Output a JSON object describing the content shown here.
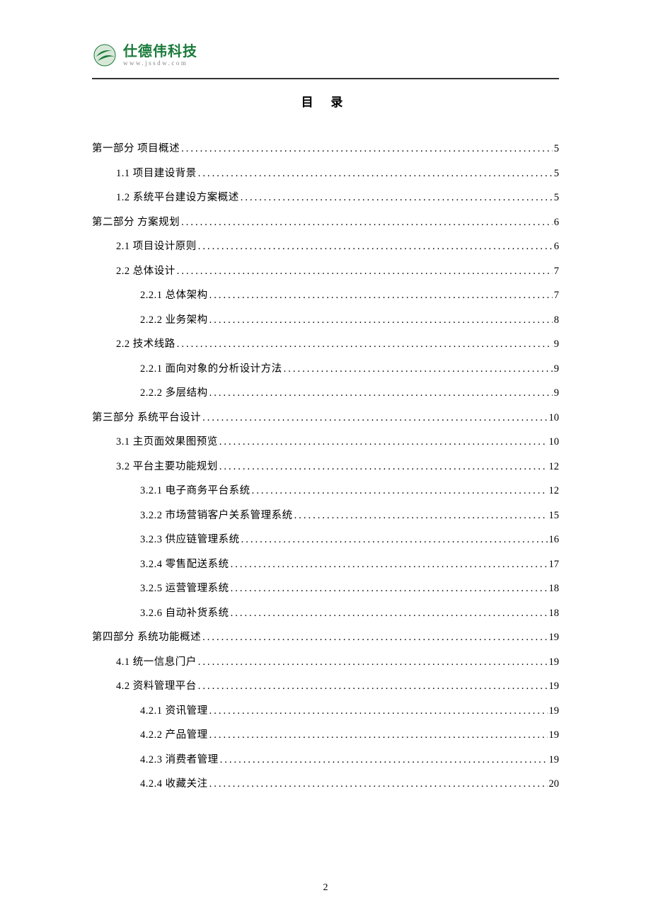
{
  "header": {
    "logo_main": "仕德伟科技",
    "logo_sub": "www.jssdw.com"
  },
  "title": "目 录",
  "toc": [
    {
      "level": 0,
      "label": "第一部分 项目概述",
      "page": "5"
    },
    {
      "level": 1,
      "label": "1.1 项目建设背景",
      "page": "5"
    },
    {
      "level": 1,
      "label": "1.2 系统平台建设方案概述",
      "page": "5"
    },
    {
      "level": 0,
      "label": "第二部分 方案规划",
      "page": "6"
    },
    {
      "level": 1,
      "label": "2.1 项目设计原则",
      "page": "6"
    },
    {
      "level": 1,
      "label": "2.2 总体设计",
      "page": "7"
    },
    {
      "level": 2,
      "label": "2.2.1 总体架构",
      "page": "7"
    },
    {
      "level": 2,
      "label": "2.2.2 业务架构",
      "page": "8"
    },
    {
      "level": 1,
      "label": "2.2 技术线路",
      "page": "9"
    },
    {
      "level": 2,
      "label": "2.2.1 面向对象的分析设计方法",
      "page": "9"
    },
    {
      "level": 2,
      "label": "2.2.2 多层结构",
      "page": "9"
    },
    {
      "level": 0,
      "label": "第三部分 系统平台设计",
      "page": "10"
    },
    {
      "level": 1,
      "label": "3.1 主页面效果图预览",
      "page": "10"
    },
    {
      "level": 1,
      "label": "3.2 平台主要功能规划",
      "page": "12"
    },
    {
      "level": 2,
      "label": "3.2.1 电子商务平台系统",
      "page": "12"
    },
    {
      "level": 2,
      "label": "3.2.2 市场营销客户关系管理系统",
      "page": "15"
    },
    {
      "level": 2,
      "label": "3.2.3 供应链管理系统 ",
      "page": "16"
    },
    {
      "level": 2,
      "label": "3.2.4 零售配送系统",
      "page": "17"
    },
    {
      "level": 2,
      "label": "3.2.5 运营管理系统",
      "page": "18"
    },
    {
      "level": 2,
      "label": "3.2.6 自动补货系统",
      "page": "18"
    },
    {
      "level": 0,
      "label": "第四部分 系统功能概述",
      "page": "19"
    },
    {
      "level": 1,
      "label": "4.1 统一信息门户",
      "page": "19"
    },
    {
      "level": 1,
      "label": "4.2 资料管理平台",
      "page": "19"
    },
    {
      "level": 2,
      "label": "4.2.1 资讯管理",
      "page": "19"
    },
    {
      "level": 2,
      "label": "4.2.2 产品管理",
      "page": "19"
    },
    {
      "level": 2,
      "label": "4.2.3 消费者管理",
      "page": "19"
    },
    {
      "level": 2,
      "label": "4.2.4 收藏关注",
      "page": "20"
    }
  ],
  "footer": {
    "page_number": "2"
  }
}
